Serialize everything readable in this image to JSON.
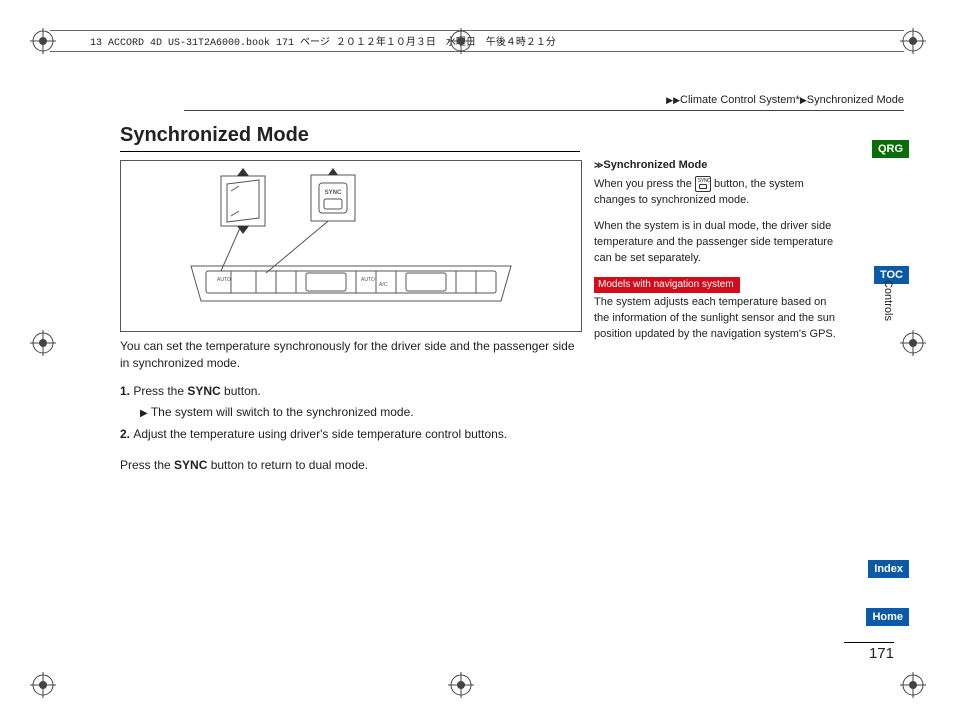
{
  "header_strip": "13 ACCORD 4D US-31T2A6000.book  171 ページ  ２０１２年１０月３日　水曜日　午後４時２１分",
  "breadcrumb": {
    "seg1": "Climate Control System*",
    "seg2": "Synchronized Mode"
  },
  "title": "Synchronized Mode",
  "diagram": {
    "sync_label": "SYNC",
    "auto_label": "AUTO",
    "ac_label": "A/C"
  },
  "body": {
    "intro": "You can set the temperature synchronously for the driver side and the passenger side in synchronized mode.",
    "step1_prefix": "1. ",
    "step1_a": "Press the ",
    "step1_bold": "SYNC",
    "step1_b": " button.",
    "step1_sub": "The system will switch to the synchronized mode.",
    "step2_prefix": "2. ",
    "step2": "Adjust the temperature using driver's side temperature control buttons.",
    "outro_a": "Press the ",
    "outro_bold": "SYNC",
    "outro_b": " button to return to dual mode."
  },
  "sidebar": {
    "heading": "Synchronized Mode",
    "p1a": "When you press the ",
    "p1b": " button, the system changes to synchronized mode.",
    "p2": "When the system is in dual mode, the driver side temperature and the passenger side temperature can be set separately.",
    "nav_badge": "Models with navigation system",
    "p3": "The system adjusts each temperature based on the information of the sunlight sensor and the sun position updated by the navigation system's GPS."
  },
  "tabs": {
    "qrg": "QRG",
    "toc": "TOC",
    "controls": "Controls",
    "index": "Index",
    "home": "Home"
  },
  "page_number": "171"
}
